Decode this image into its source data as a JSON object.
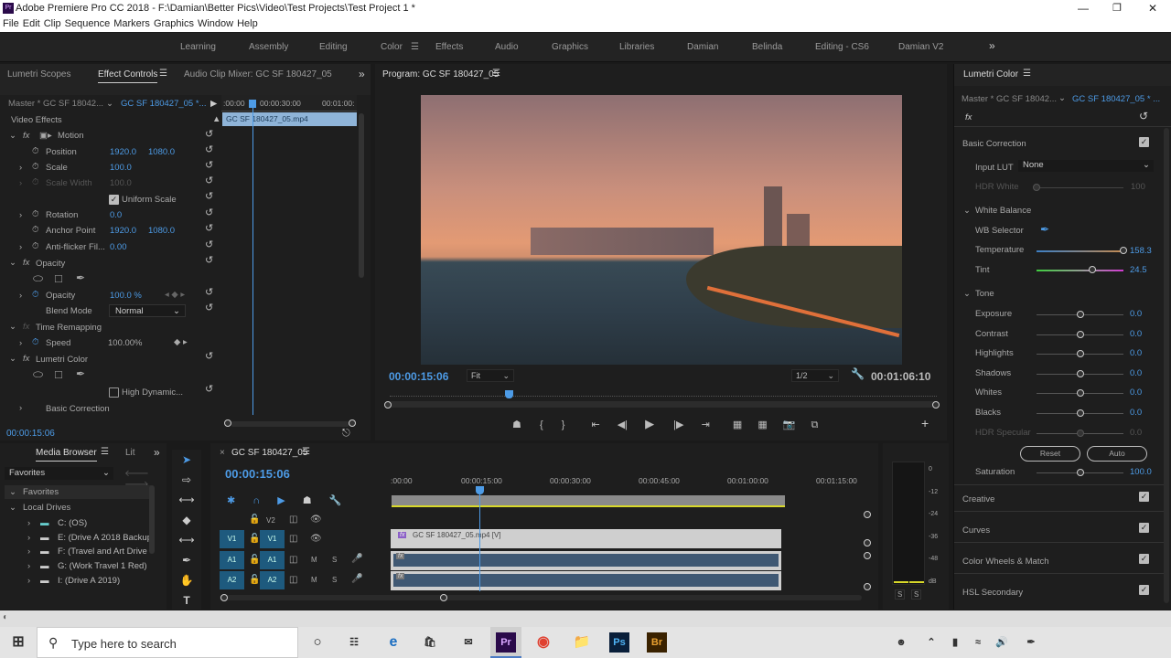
{
  "window": {
    "title": "Adobe Premiere Pro CC 2018 - F:\\Damian\\Better Pics\\Video\\Test Projects\\Test Project 1 *",
    "app_icon": "Pr"
  },
  "menu": [
    "File",
    "Edit",
    "Clip",
    "Sequence",
    "Markers",
    "Graphics",
    "Window",
    "Help"
  ],
  "workspaces": [
    "Learning",
    "Assembly",
    "Editing",
    "Color",
    "Effects",
    "Audio",
    "Graphics",
    "Libraries",
    "Damian",
    "Belinda",
    "Editing - CS6",
    "Damian V2"
  ],
  "active_workspace": "Color",
  "effect_panel": {
    "tabs": [
      "Lumetri Scopes",
      "Effect Controls",
      "Audio Clip Mixer: GC SF 180427_05"
    ],
    "master": "Master * GC SF 18042...",
    "clip": "GC SF 180427_05 *...",
    "ruler": [
      ":00:00",
      "00:00:30:00",
      "00:01:00:"
    ],
    "clip_bar": "GC SF 180427_05.mp4",
    "section": "Video Effects",
    "motion": "Motion",
    "position": {
      "label": "Position",
      "x": "1920.0",
      "y": "1080.0"
    },
    "scale": {
      "label": "Scale",
      "value": "100.0"
    },
    "scale_width": {
      "label": "Scale Width",
      "value": "100.0"
    },
    "uniform_scale": "Uniform Scale",
    "rotation": {
      "label": "Rotation",
      "value": "0.0"
    },
    "anchor": {
      "label": "Anchor Point",
      "x": "1920.0",
      "y": "1080.0"
    },
    "antiflicker": {
      "label": "Anti-flicker Fil...",
      "value": "0.00"
    },
    "opacity_fx": "Opacity",
    "opacity": {
      "label": "Opacity",
      "value": "100.0 %"
    },
    "blend": {
      "label": "Blend Mode",
      "value": "Normal"
    },
    "time_remap": "Time Remapping",
    "speed": {
      "label": "Speed",
      "value": "100.00%"
    },
    "lumetri": "Lumetri Color",
    "hdr": "High Dynamic...",
    "basic": "Basic Correction",
    "timecode": "00:00:15:06"
  },
  "program": {
    "title": "Program: GC SF 180427_05",
    "timecode": "00:00:15:06",
    "fit": "Fit",
    "resolution": "1/2",
    "duration": "00:01:06:10"
  },
  "lumetri": {
    "title": "Lumetri Color",
    "master": "Master * GC SF 18042...",
    "clip": "GC SF 180427_05 * ...",
    "basic": "Basic Correction",
    "input_lut_label": "Input LUT",
    "input_lut": "None",
    "hdr_white": {
      "label": "HDR White",
      "value": "100"
    },
    "wb": "White Balance",
    "wb_selector": "WB Selector",
    "temperature": {
      "label": "Temperature",
      "value": "158.3",
      "pos": 1.0
    },
    "tint": {
      "label": "Tint",
      "value": "24.5",
      "pos": 0.64
    },
    "tone": "Tone",
    "tone_rows": [
      {
        "label": "Exposure",
        "value": "0.0"
      },
      {
        "label": "Contrast",
        "value": "0.0"
      },
      {
        "label": "Highlights",
        "value": "0.0"
      },
      {
        "label": "Shadows",
        "value": "0.0"
      },
      {
        "label": "Whites",
        "value": "0.0"
      },
      {
        "label": "Blacks",
        "value": "0.0"
      },
      {
        "label": "HDR Specular",
        "value": "0.0"
      }
    ],
    "reset": "Reset",
    "auto": "Auto",
    "saturation": {
      "label": "Saturation",
      "value": "100.0"
    },
    "sections": [
      "Creative",
      "Curves",
      "Color Wheels & Match",
      "HSL Secondary"
    ]
  },
  "media": {
    "tabs": [
      "Media Browser",
      "Lit"
    ],
    "dropdown": "Favorites",
    "tree": [
      "Favorites",
      "Local Drives"
    ],
    "drives": [
      "C: (OS)",
      "E: (Drive A 2018 Backup)",
      "F: (Travel and Art Drive",
      "G: (Work Travel 1 Red)",
      "I: (Drive A 2019)"
    ]
  },
  "timeline": {
    "title": "GC SF 180427_05",
    "timecode": "00:00:15:06",
    "ruler": [
      ":00:00",
      "00:00:15:00",
      "00:00:30:00",
      "00:00:45:00",
      "00:01:00:00",
      "00:01:15:00"
    ],
    "tracks": {
      "v2": "V2",
      "v1": "V1",
      "a1": "A1",
      "a2": "A2",
      "m": "M",
      "s": "S"
    },
    "video_clip": "GC SF 180427_05.mp4 [V]",
    "fx": "fx"
  },
  "meter": {
    "scale": [
      "0",
      "-12",
      "-24",
      "-36",
      "-48",
      "dB"
    ],
    "solo": "S"
  },
  "taskbar": {
    "search": "Type here to search",
    "apps": [
      "Pr",
      "Ps",
      "Br"
    ]
  }
}
